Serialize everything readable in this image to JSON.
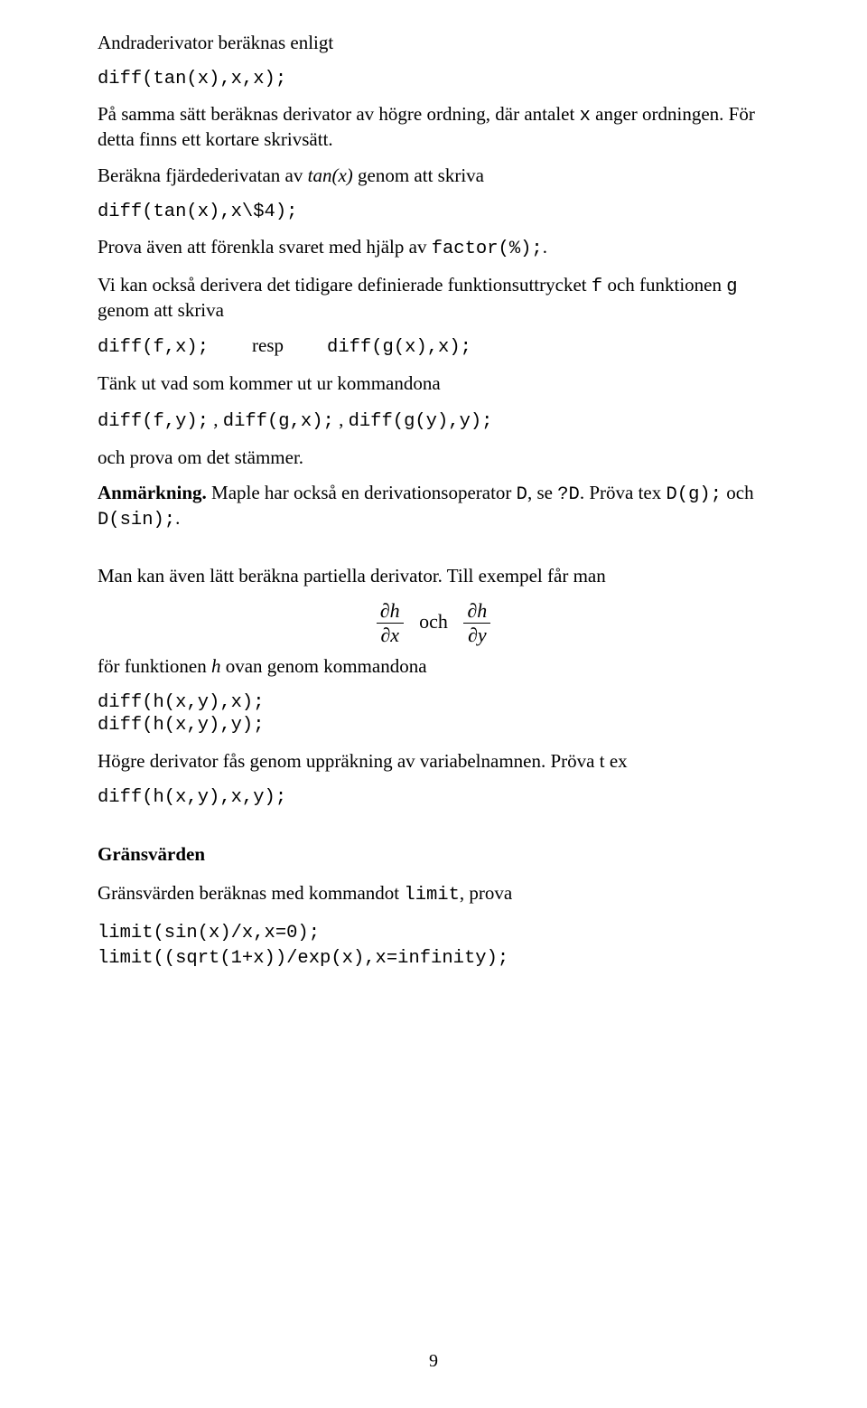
{
  "p1": "Andraderivator beräknas enligt",
  "code1": "diff(tan(x),x,x);",
  "p2_a": "På samma sätt beräknas derivator av högre ordning, där antalet ",
  "p2_code": "x",
  "p2_b": " anger ordningen. För detta finns ett kortare skrivsätt.",
  "p3_a": "Beräkna fjärdederivatan av ",
  "p3_math": "tan(x)",
  "p3_b": " genom att skriva",
  "code2": "diff(tan(x),x\\$4);",
  "p4_a": "Prova även att förenkla svaret med hjälp av ",
  "p4_code": "factor(%);",
  "p4_b": ".",
  "p5_a": "Vi kan också derivera det tidigare definierade funktionsuttrycket ",
  "p5_code_f": "f",
  "p5_b": " och funktionen ",
  "p5_code_g": "g",
  "p5_c": " genom att skriva",
  "inline_diff_fx": "diff(f,x);",
  "inline_resp": "resp",
  "inline_diff_gx": "diff(g(x),x);",
  "p6": "Tänk ut vad som kommer ut ur kommandona",
  "codes_line_a": "diff(f,y);",
  "codes_line_sep": " , ",
  "codes_line_b": "diff(g,x);",
  "codes_line_c": "diff(g(y),y);",
  "p7": "och prova om det stämmer.",
  "anm_label": "Anmärkning.",
  "anm_a": " Maple har också en derivationsoperator  ",
  "anm_D": "D",
  "anm_b": ", se ",
  "anm_qD": "?D",
  "anm_c": ". Pröva tex ",
  "anm_Dg": "D(g);",
  "anm_d": " och ",
  "anm_Dsin": "D(sin);",
  "anm_e": ".",
  "p8": "Man kan även lätt beräkna partiella derivator. Till exempel får man",
  "frac1_num": "∂h",
  "frac1_den": "∂x",
  "och": "och",
  "frac2_num": "∂h",
  "frac2_den": "∂y",
  "p9_a": "för funktionen ",
  "p9_h": "h",
  "p9_b": " ovan genom kommandona",
  "code_hxy_x": "diff(h(x,y),x);",
  "code_hxy_y": "diff(h(x,y),y);",
  "p10": "Högre derivator fås genom uppräkning av variabelnamnen. Pröva t ex",
  "code_hxy_xy": "diff(h(x,y),x,y);",
  "sec_heading": "Gränsvärden",
  "p11_a": "Gränsvärden beräknas med kommandot ",
  "p11_code": "limit",
  "p11_b": ", prova",
  "lim1": "limit(sin(x)/x,x=0);",
  "lim2": "limit((sqrt(1+x))/exp(x),x=infinity);",
  "page_num": "9"
}
